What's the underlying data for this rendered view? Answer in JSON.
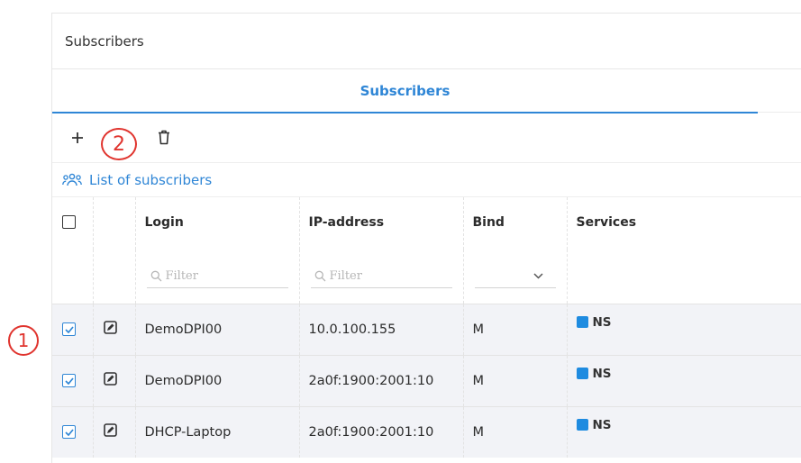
{
  "panel": {
    "title": "Subscribers"
  },
  "tabs": [
    {
      "label": "Subscribers"
    }
  ],
  "toolbar": {
    "icons": [
      "plus-icon",
      "settings-gears-icon",
      "trash-icon"
    ]
  },
  "list": {
    "title": "List of subscribers"
  },
  "table": {
    "columns": [
      "Login",
      "IP-address",
      "Bind",
      "Services"
    ],
    "filters": {
      "login": "Filter",
      "ip": "Filter"
    },
    "rows": [
      {
        "login": "DemoDPI00",
        "ip": "10.0.100.155",
        "bind": "M",
        "service": "NS",
        "checked": true
      },
      {
        "login": "DemoDPI00",
        "ip": "2a0f:1900:2001:10",
        "bind": "M",
        "service": "NS",
        "checked": true
      },
      {
        "login": "DHCP-Laptop",
        "ip": "2a0f:1900:2001:10",
        "bind": "M",
        "service": "NS",
        "checked": true
      }
    ]
  },
  "annotations": {
    "marker1": "1",
    "marker2": "2"
  },
  "colors": {
    "accent": "#2f86d6",
    "service": "#1e8be0",
    "annotation": "#e0342e",
    "row_bg": "#f2f3f7"
  }
}
